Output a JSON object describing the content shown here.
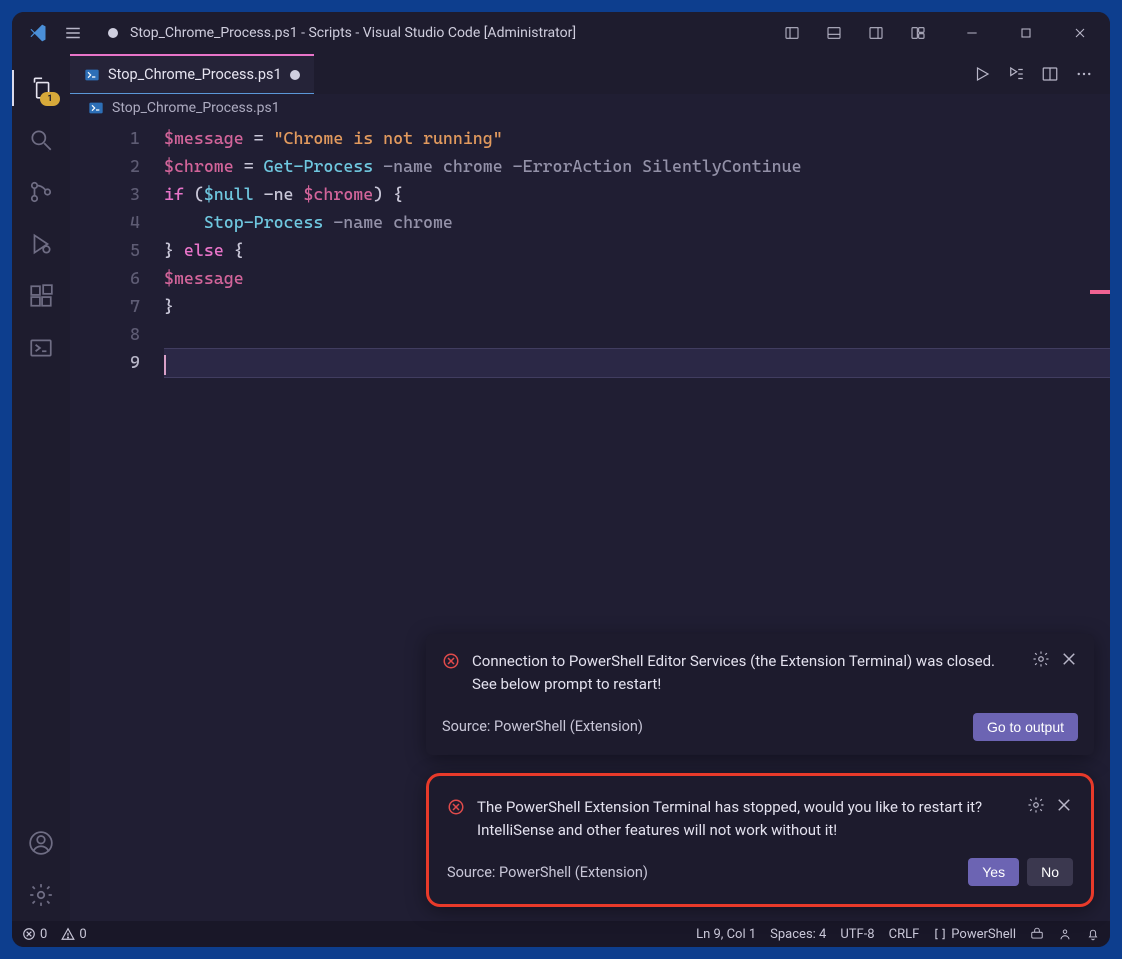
{
  "titlebar": {
    "title": "Stop_Chrome_Process.ps1 - Scripts - Visual Studio Code [Administrator]"
  },
  "activitybar": {
    "explorer_badge": "1"
  },
  "tab": {
    "label": "Stop_Chrome_Process.ps1",
    "modified": true
  },
  "breadcrumb": {
    "file": "Stop_Chrome_Process.ps1"
  },
  "code": {
    "lines": [
      {
        "n": "1",
        "tokens": [
          [
            "var",
            "$message"
          ],
          [
            "op",
            " = "
          ],
          [
            "str",
            "\"Chrome is not running\""
          ]
        ]
      },
      {
        "n": "2",
        "tokens": [
          [
            "var",
            "$chrome"
          ],
          [
            "op",
            " = "
          ],
          [
            "cmd",
            "Get-Process"
          ],
          [
            "param",
            " -name chrome -ErrorAction SilentlyContinue"
          ]
        ]
      },
      {
        "n": "3",
        "tokens": [
          [
            "kw",
            "if"
          ],
          [
            "op",
            " ("
          ],
          [
            "cmd",
            "$null"
          ],
          [
            "op",
            " -ne "
          ],
          [
            "var",
            "$chrome"
          ],
          [
            "op",
            ") "
          ],
          [
            "brace",
            "{"
          ]
        ]
      },
      {
        "n": "4",
        "tokens": [
          [
            "op",
            "    "
          ],
          [
            "cmd",
            "Stop-Process"
          ],
          [
            "param",
            " -name chrome"
          ]
        ]
      },
      {
        "n": "5",
        "tokens": [
          [
            "brace",
            "}"
          ],
          [
            "kw",
            " else "
          ],
          [
            "brace",
            "{"
          ]
        ]
      },
      {
        "n": "6",
        "tokens": [
          [
            "var",
            "$message"
          ]
        ]
      },
      {
        "n": "7",
        "tokens": [
          [
            "brace",
            "}"
          ]
        ]
      },
      {
        "n": "8",
        "tokens": []
      },
      {
        "n": "9",
        "tokens": [],
        "cursor": true,
        "highlight": true
      }
    ]
  },
  "statusbar": {
    "errors": "0",
    "warnings": "0",
    "lncol": "Ln 9, Col 1",
    "spaces": "Spaces: 4",
    "encoding": "UTF-8",
    "eol": "CRLF",
    "lang": "PowerShell"
  },
  "toasts": [
    {
      "message": "Connection to PowerShell Editor Services (the Extension Terminal) was closed. See below prompt to restart!",
      "source": "Source: PowerShell (Extension)",
      "buttons": [
        {
          "label": "Go to output",
          "kind": "primary"
        }
      ],
      "highlighted": false
    },
    {
      "message": "The PowerShell Extension Terminal has stopped, would you like to restart it? IntelliSense and other features will not work without it!",
      "source": "Source: PowerShell (Extension)",
      "buttons": [
        {
          "label": "Yes",
          "kind": "primary"
        },
        {
          "label": "No",
          "kind": "secondary"
        }
      ],
      "highlighted": true
    }
  ]
}
